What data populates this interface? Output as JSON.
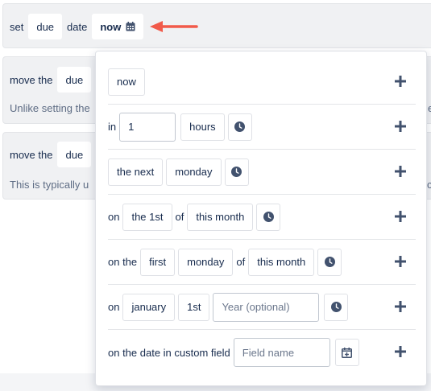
{
  "card1": {
    "set": "set",
    "field": "due",
    "date": "date",
    "value": "now"
  },
  "card2": {
    "move": "move the",
    "field": "due",
    "desc": "Unlike setting the"
  },
  "card3": {
    "move": "move the",
    "field": "due",
    "desc": "This is typically u"
  },
  "card2_trail": "e",
  "card3_trail": "c",
  "popover": {
    "row1": {
      "now": "now"
    },
    "row2": {
      "in": "in",
      "amount": "1",
      "unit": "hours"
    },
    "row3": {
      "prefix": "the next",
      "day": "monday"
    },
    "row4": {
      "on": "on",
      "ordinal": "the 1st",
      "of": "of",
      "period": "this month"
    },
    "row5": {
      "on": "on the",
      "ordinal": "first",
      "day": "monday",
      "of": "of",
      "period": "this month"
    },
    "row6": {
      "on": "on",
      "month": "january",
      "day": "1st",
      "year_placeholder": "Year (optional)"
    },
    "row7": {
      "label": "on the date in custom field",
      "field_placeholder": "Field name"
    }
  },
  "colors": {
    "accent_arrow": "#f15a4a",
    "icon": "#42526e",
    "bg_card": "#f0f1f3"
  },
  "icons": [
    "calendar-icon",
    "clock-icon",
    "plus-icon",
    "calendar-plus-icon"
  ]
}
